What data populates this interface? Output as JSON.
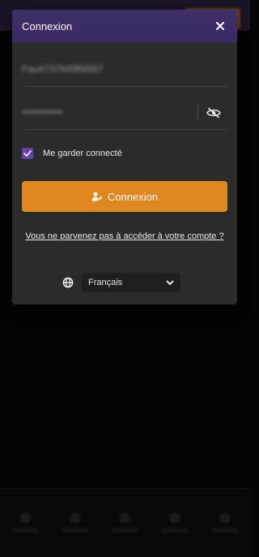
{
  "modal": {
    "title": "Connexion",
    "username_value": "Fau4737849ff4567",
    "password_value": "••••••••••••",
    "remember_label": "Me garder connecté",
    "remember_checked": true,
    "login_label": "Connexion",
    "help_link": "Vous ne parvenez pas à accéder à votre compte ?",
    "language": "Français"
  },
  "colors": {
    "header": "#3e2f6a",
    "accent": "#e0871f",
    "checkbox": "#6a3ca8",
    "modal_bg": "#2b2b2b"
  },
  "icons": {
    "close": "close-icon",
    "eye": "eye-slash-icon",
    "user": "user-edit-icon",
    "globe": "globe-icon",
    "chevron": "chevron-down-icon"
  }
}
